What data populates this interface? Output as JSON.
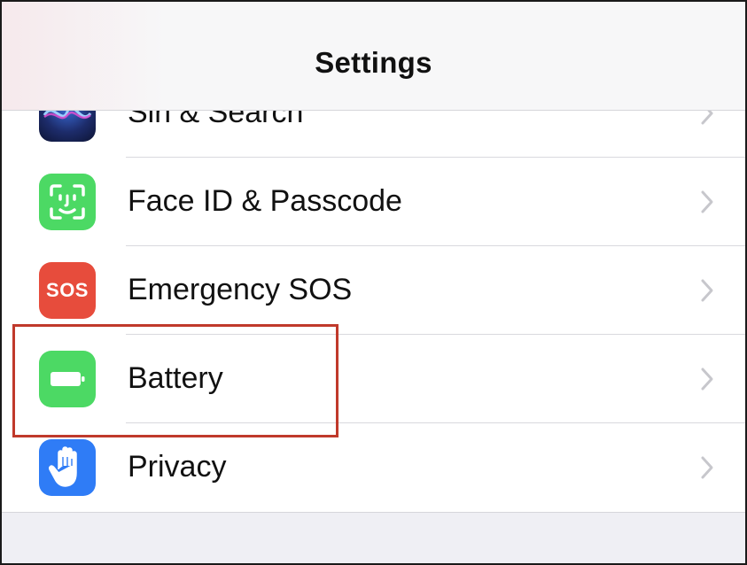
{
  "header": {
    "title": "Settings"
  },
  "settings_rows": [
    {
      "label": "Siri & Search",
      "icon": "siri-icon"
    },
    {
      "label": "Face ID & Passcode",
      "icon": "face-id-icon"
    },
    {
      "label": "Emergency SOS",
      "icon": "sos-icon",
      "icon_text": "SOS"
    },
    {
      "label": "Battery",
      "icon": "battery-icon"
    },
    {
      "label": "Privacy",
      "icon": "hand-icon"
    }
  ],
  "annotation": {
    "highlighted_row": "Battery",
    "highlight_color": "#c0392b"
  },
  "colors": {
    "green_icon": "#4cd964",
    "sos_red": "#e74c3c",
    "privacy_blue": "#2f7cf6",
    "chevron": "#c7c7cc"
  }
}
